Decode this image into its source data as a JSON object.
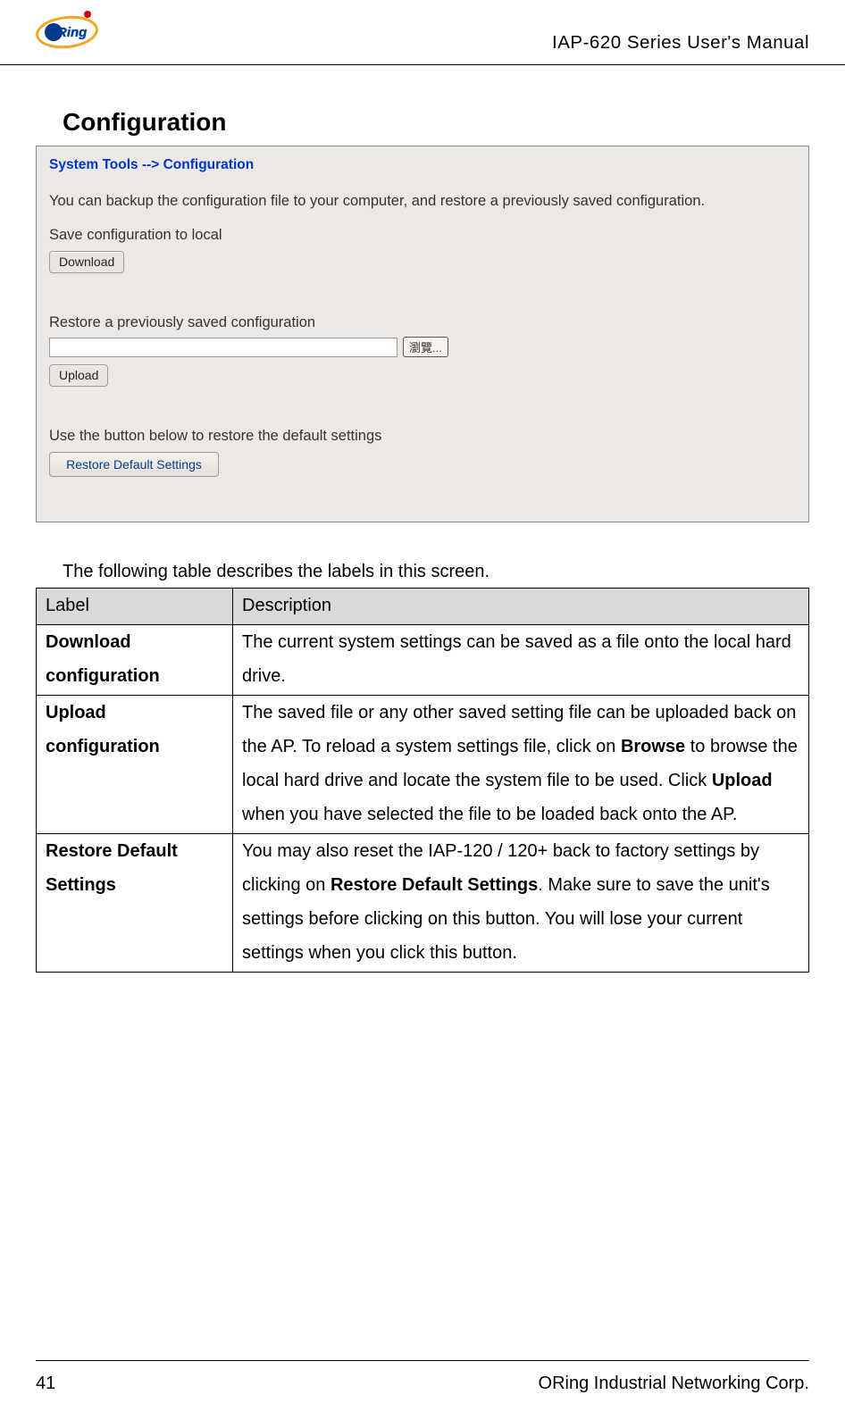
{
  "header": {
    "logo_text": "Ring",
    "title": "IAP-620  Series  User's  Manual"
  },
  "section_heading": "Configuration",
  "screenshot": {
    "breadcrumb": "System Tools --> Configuration",
    "intro": "You can backup the configuration file to your computer, and restore a previously saved configuration.",
    "save_label": "Save configuration to local",
    "download_btn": "Download",
    "restore_label": "Restore a previously saved configuration",
    "browse_btn": "瀏覽...",
    "upload_btn": "Upload",
    "default_label": "Use the button below to restore the default settings",
    "restore_default_btn": "Restore Default Settings"
  },
  "intro_line": "The following table describes the labels in this screen.",
  "table": {
    "head_label": "Label",
    "head_desc": "Description",
    "rows": [
      {
        "label": "Download configuration",
        "desc_plain": "The current system settings can be saved as a file onto the local hard drive."
      },
      {
        "label": "Upload configuration",
        "desc_parts": {
          "p1": "The saved file or any other saved setting file can be uploaded back on the AP.    To reload a system settings file, click on ",
          "b1": "Browse",
          "p2": " to browse the local hard drive and locate the system file to be used.    Click ",
          "b2": "Upload",
          "p3": " when you have selected the file to be loaded back onto the AP."
        }
      },
      {
        "label": "Restore Default Settings",
        "desc_parts": {
          "p1": "You may also reset the IAP-120 / 120+ back to factory settings by clicking on ",
          "b1": "Restore Default Settings",
          "p2": ".    Make sure to save the unit's settings before clicking on this button.    You will lose your current settings when you click this button."
        }
      }
    ]
  },
  "footer": {
    "page_number": "41",
    "company": "ORing Industrial Networking Corp."
  }
}
